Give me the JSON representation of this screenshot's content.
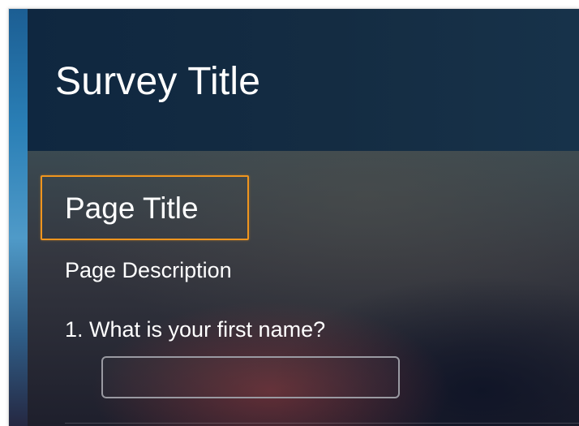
{
  "survey": {
    "title": "Survey Title"
  },
  "page": {
    "title": "Page Title",
    "description": "Page Description"
  },
  "questions": [
    {
      "label": "1. What is your first name?",
      "value": "",
      "placeholder": ""
    }
  ],
  "colors": {
    "highlight_border": "#f0951e",
    "header_bg": "#0f2740",
    "text": "#ffffff"
  }
}
